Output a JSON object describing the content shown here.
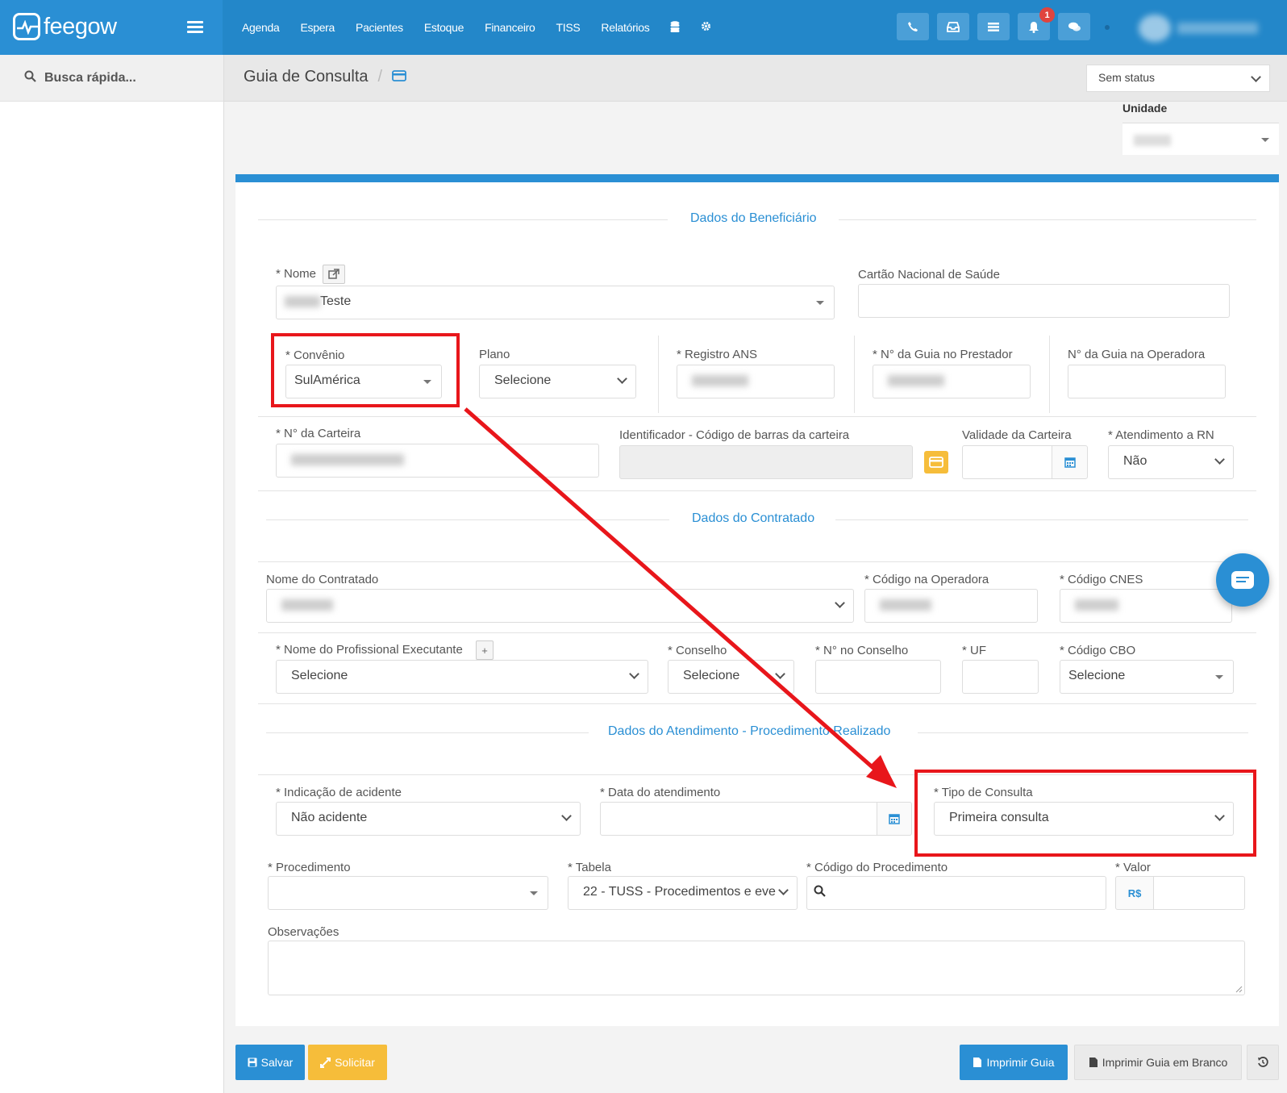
{
  "brand": {
    "name": "feegow"
  },
  "nav": {
    "items": [
      "Agenda",
      "Espera",
      "Pacientes",
      "Estoque",
      "Financeiro",
      "TISS",
      "Relatórios"
    ],
    "database_icon": "database-icon",
    "settings_icon": "gear-icon"
  },
  "toolbar": {
    "icons": [
      "phone-icon",
      "inbox-icon",
      "list-icon",
      "bell-icon",
      "chat-icon"
    ],
    "notification_count": "1"
  },
  "sidebar": {
    "search_label": "Busca rápida..."
  },
  "header": {
    "title": "Guia de Consulta",
    "separator": "/",
    "status_value": "Sem status",
    "unit_label": "Unidade"
  },
  "sections": {
    "beneficiario": "Dados do Beneficiário",
    "contratado": "Dados do Contratado",
    "atendimento": "Dados do Atendimento - Procedimento Realizado"
  },
  "beneficiario": {
    "nome_label": "* Nome",
    "nome_value": "Teste",
    "cns_label": "Cartão Nacional de Saúde",
    "convenio_label": "* Convênio",
    "convenio_value": "SulAmérica",
    "plano_label": "Plano",
    "plano_value": "Selecione",
    "registro_label": "* Registro ANS",
    "guia_prestador_label": "* N° da Guia no Prestador",
    "guia_operadora_label": "N° da Guia na Operadora",
    "carteira_label": "* N° da Carteira",
    "identificador_label": "Identificador - Código de barras da carteira",
    "validade_label": "Validade da Carteira",
    "rn_label": "* Atendimento a RN",
    "rn_value": "Não"
  },
  "contratado": {
    "nome_label": "Nome do Contratado",
    "codigo_operadora_label": "* Código na Operadora",
    "cnes_label": "* Código CNES",
    "profissional_label": "* Nome do Profissional Executante",
    "profissional_add": "+",
    "profissional_value": "Selecione",
    "conselho_label": "* Conselho",
    "conselho_value": "Selecione",
    "n_conselho_label": "* N° no Conselho",
    "uf_label": "* UF",
    "cbo_label": "* Código CBO",
    "cbo_value": "Selecione"
  },
  "atendimento": {
    "acidente_label": "* Indicação de acidente",
    "acidente_value": "Não acidente",
    "data_label": "* Data do atendimento",
    "tipo_label": "* Tipo de Consulta",
    "tipo_value": "Primeira consulta",
    "procedimento_label": "* Procedimento",
    "tabela_label": "* Tabela",
    "tabela_value": "22 - TUSS - Procedimentos e eve",
    "codigo_label": "* Código do Procedimento",
    "valor_label": "* Valor",
    "valor_prefix": "R$",
    "obs_label": "Observações"
  },
  "actions": {
    "salvar": "Salvar",
    "solicitar": "Solicitar",
    "imprimir": "Imprimir Guia",
    "imprimir_branco": "Imprimir Guia em Branco"
  },
  "colors": {
    "primary": "#2a8fd4",
    "topbar": "#2387c9",
    "warning": "#f6bd3a",
    "annotation": "#e8161b"
  }
}
